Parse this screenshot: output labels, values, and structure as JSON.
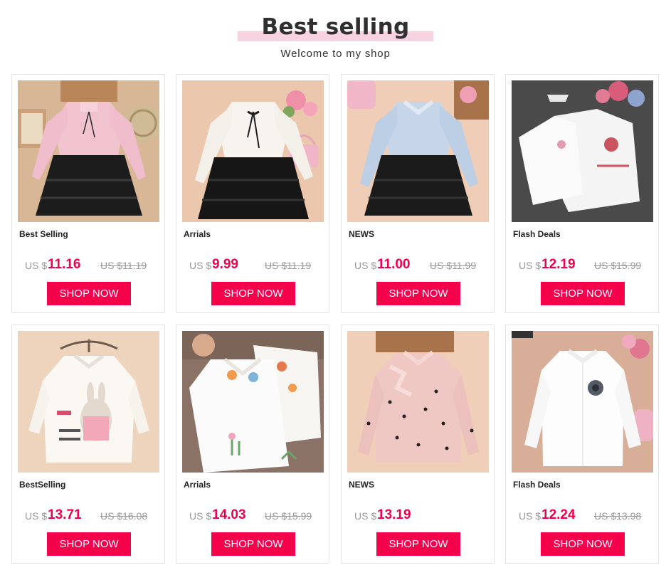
{
  "header": {
    "title": "Best selling",
    "subtitle": "Welcome to my shop"
  },
  "colors": {
    "accent": "#f5004b",
    "price": "#f0004b",
    "title_highlight": "#f7d3e1"
  },
  "products": [
    {
      "name": "Best Selling",
      "currency": "US $",
      "price": "11.16",
      "old_price": "US $11.19",
      "button": "SHOP NOW",
      "image": "pink-ruffle-blouse-black-tutu-skirt"
    },
    {
      "name": "Arrials",
      "currency": "US $",
      "price": "9.99",
      "old_price": "US $11.19",
      "button": "SHOP NOW",
      "image": "white-blouse-bow-black-tutu-skirt"
    },
    {
      "name": "NEWS",
      "currency": "US $",
      "price": "11.00",
      "old_price": "US $11.99",
      "button": "SHOP NOW",
      "image": "blue-ruffle-blouse-black-skirt"
    },
    {
      "name": "Flash Deals",
      "currency": "US $",
      "price": "12.19",
      "old_price": "US $15.99",
      "button": "SHOP NOW",
      "image": "white-embroidered-shirts-pair"
    },
    {
      "name": "BestSelling",
      "currency": "US $",
      "price": "13.71",
      "old_price": "US $16.08",
      "button": "SHOP NOW",
      "image": "white-shirt-bunny-print-on-hanger"
    },
    {
      "name": "Arrials",
      "currency": "US $",
      "price": "14.03",
      "old_price": "US $15.99",
      "button": "SHOP NOW",
      "image": "white-shirts-fox-embroidery"
    },
    {
      "name": "NEWS",
      "currency": "US $",
      "price": "13.19",
      "old_price": "",
      "button": "SHOP NOW",
      "image": "pink-polka-dot-ruffle-blouse"
    },
    {
      "name": "Flash Deals",
      "currency": "US $",
      "price": "12.24",
      "old_price": "US $13.98",
      "button": "SHOP NOW",
      "image": "white-blouse-flower-brooch"
    }
  ]
}
